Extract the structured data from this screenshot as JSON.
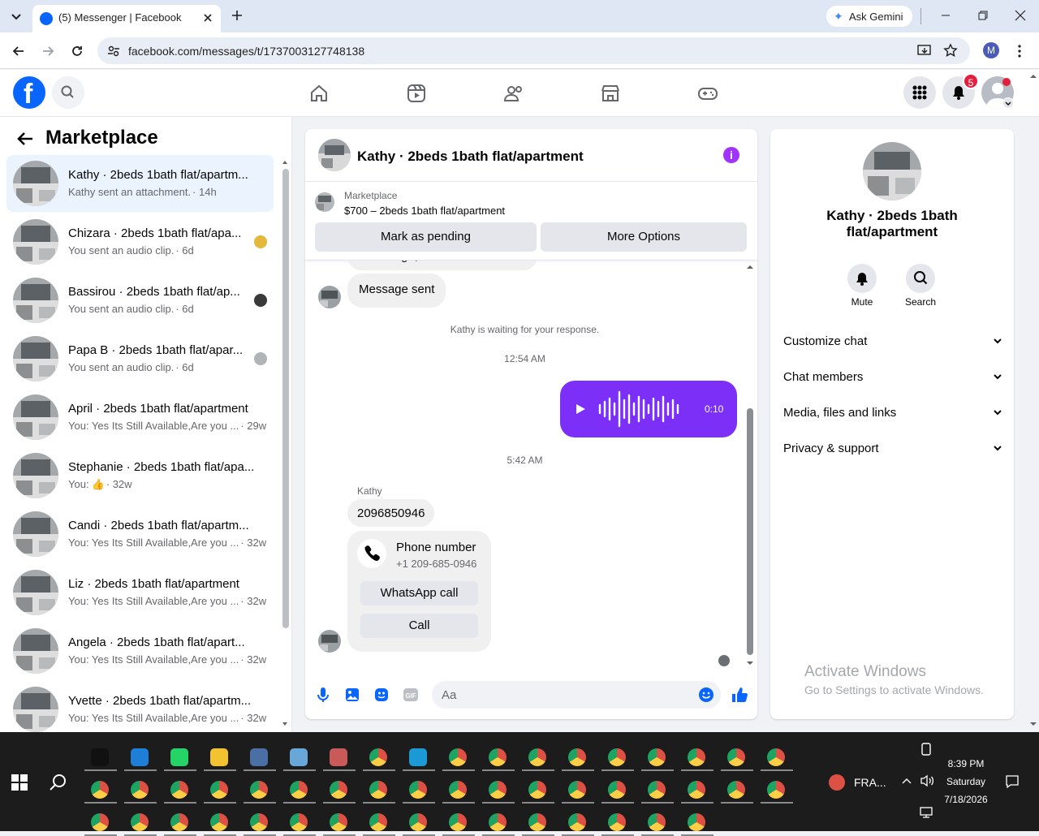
{
  "browser": {
    "tab_title": "(5) Messenger | Facebook",
    "url": "facebook.com/messages/t/1737003127748138",
    "ask_gemini": "Ask Gemini",
    "profile_initial": "M"
  },
  "fb_header": {
    "notifications_count": "5",
    "brand_color": "#0866ff"
  },
  "sidebar": {
    "title": "Marketplace",
    "conversations": [
      {
        "name": "Kathy · 2beds 1bath flat/apartm...",
        "preview": "Kathy sent an attachment.",
        "time": "· 14h",
        "active": true
      },
      {
        "name": "Chizara · 2beds 1bath flat/apa...",
        "preview": "You sent an audio clip.",
        "time": "· 6d"
      },
      {
        "name": "Bassirou · 2beds 1bath flat/ap...",
        "preview": "You sent an audio clip.",
        "time": "· 6d"
      },
      {
        "name": "Papa B · 2beds 1bath flat/apar...",
        "preview": "You sent an audio clip.",
        "time": "· 6d"
      },
      {
        "name": "April · 2beds 1bath flat/apartment",
        "preview": "You: Yes Its Still Available,Are you ...",
        "time": "· 29w"
      },
      {
        "name": "Stephanie · 2beds 1bath flat/apa...",
        "preview": "You:",
        "time": "· 32w"
      },
      {
        "name": "Candi · 2beds 1bath flat/apartm...",
        "preview": "You: Yes Its Still Available,Are you ...",
        "time": "· 32w"
      },
      {
        "name": "Liz · 2beds 1bath flat/apartment",
        "preview": "You: Yes Its Still Available,Are you ...",
        "time": "· 32w"
      },
      {
        "name": "Angela · 2beds 1bath flat/apart...",
        "preview": "You: Yes Its Still Available,Are you ...",
        "time": "· 32w"
      },
      {
        "name": "Yvette · 2beds 1bath flat/apartm...",
        "preview": "You: Yes Its Still Available,Are you ...",
        "time": "· 32w"
      }
    ]
  },
  "chat": {
    "title": "Kathy · 2beds 1bath flat/apartment",
    "marketplace_label": "Marketplace",
    "listing": "$700 – 2beds 1bath flat/apartment",
    "mark_pending": "Mark as pending",
    "more_options": "More Options",
    "cut_msg": "Hi Rodrigo, is this still available?",
    "message_sent": "Message sent",
    "waiting": "Kathy is waiting for your response.",
    "time1": "12:54 AM",
    "audio_duration": "0:10",
    "time2": "5:42 AM",
    "sender": "Kathy",
    "phone_msg": "2096850946",
    "phone_card_title": "Phone number",
    "phone_card_number": "+1 209-685-0946",
    "whatsapp_call": "WhatsApp call",
    "call": "Call",
    "input_placeholder": "Aa",
    "accent": "#7b2ff7"
  },
  "details": {
    "name": "Kathy · 2beds 1bath flat/apartment",
    "mute": "Mute",
    "search": "Search",
    "rows": [
      "Customize chat",
      "Chat members",
      "Media, files and links",
      "Privacy & support"
    ],
    "watermark_title": "Activate Windows",
    "watermark_sub": "Go to Settings to activate Windows."
  },
  "taskbar": {
    "tray_lang": "FRA...",
    "clock_time": "8:39 PM",
    "clock_day": "Saturday",
    "clock_date": "7/18/2026"
  }
}
